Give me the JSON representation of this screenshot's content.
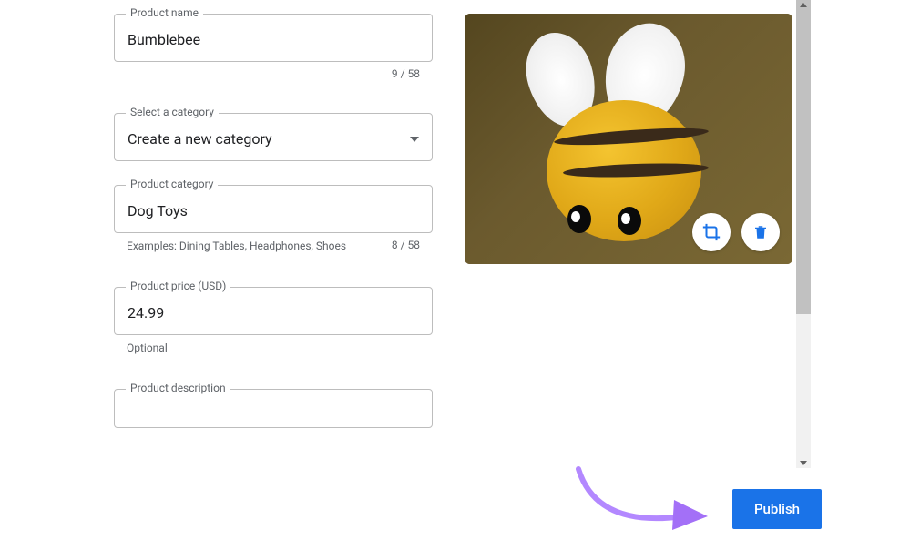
{
  "fields": {
    "product_name": {
      "label": "Product name",
      "value": "Bumblebee",
      "counter": "9 / 58"
    },
    "category_select": {
      "label": "Select a category",
      "value": "Create a new category"
    },
    "product_category": {
      "label": "Product category",
      "value": "Dog Toys",
      "helper": "Examples: Dining Tables, Headphones, Shoes",
      "counter": "8 / 58"
    },
    "product_price": {
      "label": "Product price (USD)",
      "value": "24.99",
      "helper": "Optional"
    },
    "product_description": {
      "label": "Product description"
    }
  },
  "footer": {
    "publish_label": "Publish"
  },
  "image": {
    "alt": "Crocheted bumblebee plush toy"
  }
}
